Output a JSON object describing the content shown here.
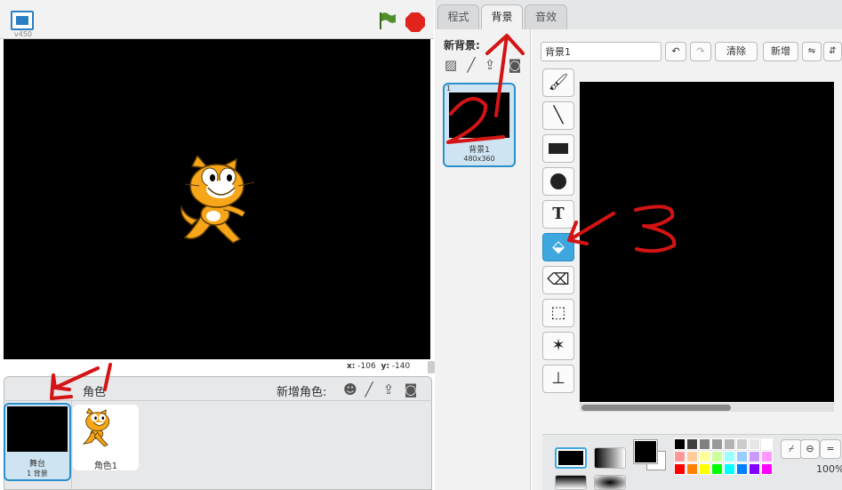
{
  "stage": {
    "version": "v450",
    "coords": {
      "x_label": "x:",
      "x_value": "-106",
      "y_label": "y:",
      "y_value": "-140"
    }
  },
  "sprites_pane": {
    "sprite_label": "角色",
    "new_sprite_label": "新增角色:",
    "stage_thumb": {
      "name": "舞台",
      "count": "1 背景"
    },
    "sprite_card": {
      "name": "角色1"
    }
  },
  "tabs": [
    {
      "label": "程式"
    },
    {
      "label": "背景"
    },
    {
      "label": "音效"
    }
  ],
  "backdrops": {
    "new_label": "新背景:",
    "card": {
      "number": "1",
      "name": "背景1",
      "size": "480x360"
    }
  },
  "editor": {
    "name_value": "背景1",
    "clear_label": "清除",
    "add_label": "新增",
    "tools": [
      {
        "name": "brush"
      },
      {
        "name": "line"
      },
      {
        "name": "rectangle"
      },
      {
        "name": "ellipse"
      },
      {
        "name": "text",
        "glyph": "T"
      },
      {
        "name": "fill"
      },
      {
        "name": "eraser"
      },
      {
        "name": "select"
      },
      {
        "name": "select-and-duplicate"
      },
      {
        "name": "stamp"
      }
    ],
    "zoom": "100%",
    "palette": [
      "#000000",
      "#404040",
      "#808080",
      "#999999",
      "#b3b3b3",
      "#cccccc",
      "#e6e6e6",
      "#ffffff",
      "#ff9999",
      "#ffcc99",
      "#ffff99",
      "#ccff99",
      "#99ffff",
      "#99ccff",
      "#cc99ff",
      "#ff99ff",
      "#ff0000",
      "#ff8000",
      "#ffff00",
      "#00ff00",
      "#00ffff",
      "#0080ff",
      "#8000ff",
      "#ff00ff"
    ],
    "accent": "#3ea7dd"
  },
  "annotations": {
    "step1": "1",
    "step2": "2",
    "step3": "3"
  }
}
